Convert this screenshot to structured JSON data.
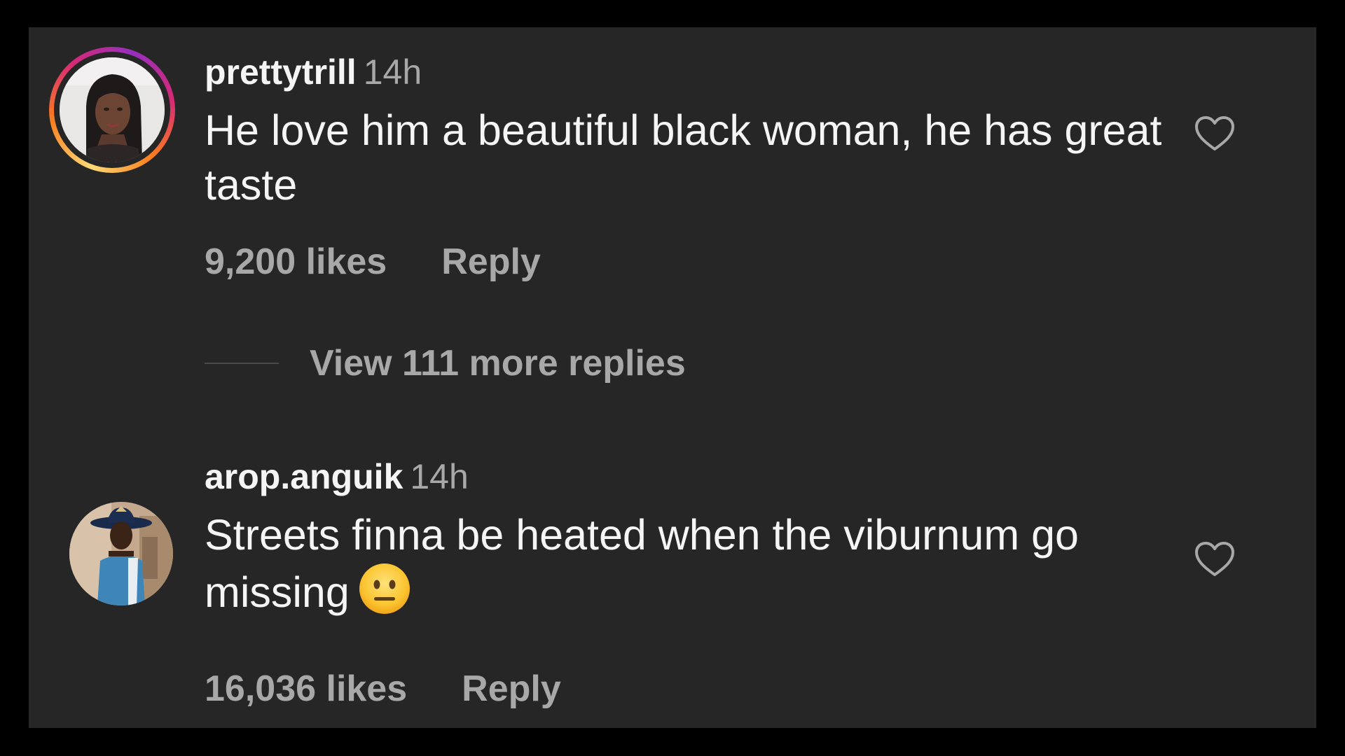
{
  "colors": {
    "background": "#262626",
    "outer_border": "#000000",
    "primary_text": "#f5f5f5",
    "secondary_text": "#a8a8a8",
    "story_ring": [
      "#feda75",
      "#fa7e1e",
      "#d62976",
      "#962fbf"
    ]
  },
  "comments": [
    {
      "username": "prettytrill",
      "timestamp": "14h",
      "text": "He love him a beautiful black woman, he has great taste",
      "likes": "9,200 likes",
      "reply_label": "Reply",
      "has_story_ring": true,
      "avatar_icon": "profile-photo",
      "like_icon": "heart-outline-icon",
      "view_replies": "View 111 more replies"
    },
    {
      "username": "arop.anguik",
      "timestamp": "14h",
      "text": "Streets finna be heated when the viburnum go missing",
      "emoji": "😐",
      "emoji_icon": "neutral-face-emoji",
      "likes": "16,036 likes",
      "reply_label": "Reply",
      "has_story_ring": false,
      "avatar_icon": "profile-photo",
      "like_icon": "heart-outline-icon"
    }
  ]
}
